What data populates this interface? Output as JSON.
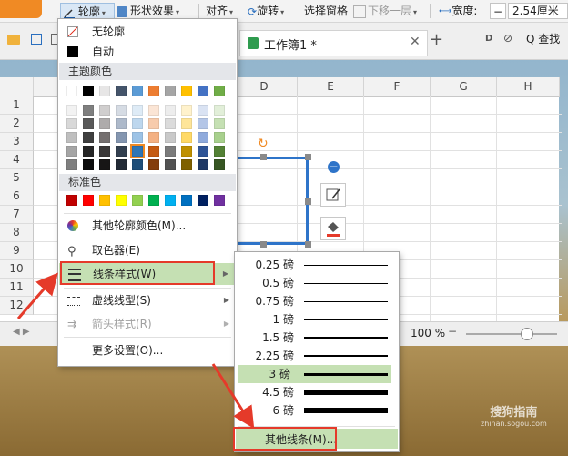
{
  "ribbon": {
    "outline": "轮廓",
    "shape_effects": "形状效果",
    "align": "对齐",
    "rotate": "旋转",
    "selection_pane": "选择窗格",
    "move_down": "下移一层",
    "width_label": "宽度:",
    "width_value": "2.54厘米"
  },
  "tabs": {
    "workbook": "工作簿1 *",
    "search": "Q 查找"
  },
  "sheet": {
    "columns": [
      "D",
      "E",
      "F",
      "G",
      "H"
    ],
    "rows": [
      "1",
      "2",
      "3",
      "4",
      "5",
      "6",
      "7",
      "8",
      "9",
      "10",
      "11",
      "12"
    ],
    "zoom": "100 %"
  },
  "outline_menu": {
    "no_outline": "无轮廓",
    "auto": "自动",
    "theme_colors": "主题颜色",
    "standard_colors": "标准色",
    "more_colors": "其他轮廓颜色(M)...",
    "eyedropper": "取色器(E)",
    "line_style": "线条样式(W)",
    "dash_type": "虚线线型(S)",
    "arrow_style": "箭头样式(R)",
    "more_settings": "更多设置(O)...",
    "theme_top": [
      "#ffffff",
      "#000000",
      "#e7e6e6",
      "#44546a",
      "#5b9bd5",
      "#ed7d31",
      "#a5a5a5",
      "#ffc000",
      "#4472c4",
      "#70ad47"
    ],
    "theme_shades": [
      [
        "#f2f2f2",
        "#7f7f7f",
        "#d0cece",
        "#d6dce4",
        "#deebf6",
        "#fbe5d5",
        "#ededed",
        "#fff2cc",
        "#dae3f3",
        "#e2efd9"
      ],
      [
        "#d8d8d8",
        "#595959",
        "#aeabab",
        "#adb9ca",
        "#bdd7ee",
        "#f7cbac",
        "#dbdbdb",
        "#fee599",
        "#b4c6e7",
        "#c5e0b3"
      ],
      [
        "#bfbfbf",
        "#3f3f3f",
        "#757070",
        "#8496b0",
        "#9dc3e6",
        "#f4b183",
        "#c9c9c9",
        "#ffd966",
        "#8faadc",
        "#a8d08d"
      ],
      [
        "#a5a5a5",
        "#262626",
        "#3a3838",
        "#323f4f",
        "#2e75b5",
        "#c55a11",
        "#7b7b7b",
        "#bf9000",
        "#2f5496",
        "#538135"
      ],
      [
        "#7f7f7f",
        "#0c0c0c",
        "#171616",
        "#222a35",
        "#1e4e79",
        "#833c0b",
        "#525252",
        "#7f6000",
        "#1f3864",
        "#375623"
      ]
    ],
    "standard": [
      "#c00000",
      "#ff0000",
      "#ffc000",
      "#ffff00",
      "#92d050",
      "#00b050",
      "#00b0f0",
      "#0070c0",
      "#002060",
      "#7030a0"
    ]
  },
  "line_menu": {
    "items": [
      "0.25 磅",
      "0.5 磅",
      "0.75 磅",
      "1 磅",
      "1.5 磅",
      "2.25 磅",
      "3 磅",
      "4.5 磅",
      "6 磅"
    ],
    "weights": [
      0.25,
      0.5,
      0.75,
      1,
      1.5,
      2.25,
      3,
      4.5,
      6
    ],
    "selected": "3 磅",
    "more_lines": "其他线条(M)..."
  },
  "watermark": {
    "brand": "搜狗指南",
    "url": "zhinan.sogou.com"
  },
  "colors": {
    "highlight": "#c5e0b3",
    "red_annotation": "#e53a2a",
    "accent_orange": "#f08a24"
  }
}
